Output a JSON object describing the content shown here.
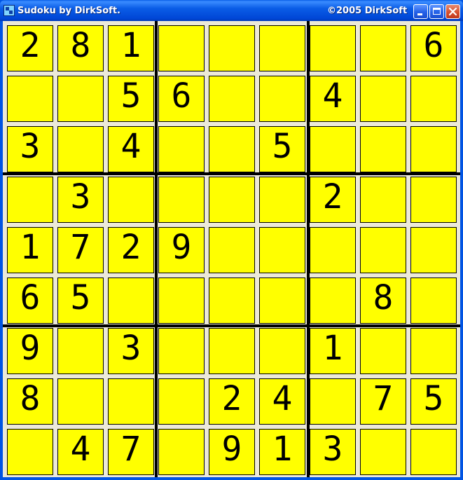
{
  "window": {
    "title": "Sudoku by DirkSoft.",
    "copyright": "©2005 DirkSoft",
    "buttons": [
      "minimize",
      "maximize",
      "close"
    ]
  },
  "colors": {
    "cell_background": "#ffff00",
    "title_bar": "#0054e3",
    "board_background": "#ece9d8"
  },
  "board": {
    "rows": [
      [
        "2",
        "8",
        "1",
        "",
        "",
        "",
        "",
        "",
        "6"
      ],
      [
        "",
        "",
        "5",
        "6",
        "",
        "",
        "4",
        "",
        ""
      ],
      [
        "3",
        "",
        "4",
        "",
        "",
        "5",
        "",
        "",
        ""
      ],
      [
        "",
        "3",
        "",
        "",
        "",
        "",
        "2",
        "",
        ""
      ],
      [
        "1",
        "7",
        "2",
        "9",
        "",
        "",
        "",
        "",
        ""
      ],
      [
        "6",
        "5",
        "",
        "",
        "",
        "",
        "",
        "8",
        ""
      ],
      [
        "9",
        "",
        "3",
        "",
        "",
        "",
        "1",
        "",
        ""
      ],
      [
        "8",
        "",
        "",
        "",
        "2",
        "4",
        "",
        "7",
        "5"
      ],
      [
        "",
        "4",
        "7",
        "",
        "9",
        "1",
        "3",
        "",
        ""
      ]
    ]
  }
}
